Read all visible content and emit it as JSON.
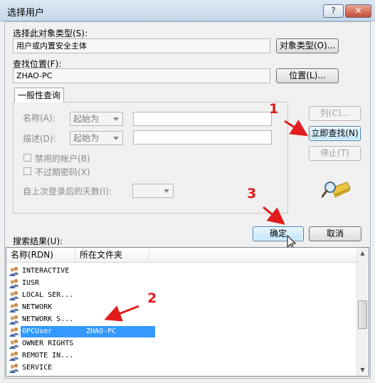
{
  "window": {
    "title": "选择用户",
    "help_label": "?",
    "close_label": "✕"
  },
  "object_type": {
    "label": "选择此对象类型(S):",
    "value": "用户或内置安全主体",
    "button": "对象类型(O)..."
  },
  "location": {
    "label": "查找位置(F):",
    "value": "ZHAO-PC",
    "button": "位置(L)..."
  },
  "query": {
    "tab": "一般性查询",
    "name_label": "名称(A):",
    "name_combo": "起始为",
    "desc_label": "描述(D):",
    "desc_combo": "起始为",
    "disabled_accounts": "禁用的帐户(B)",
    "no_expire_password": "不过期密码(X)",
    "days_since_login": "自上次登录后的天数(I):"
  },
  "side_buttons": {
    "columns": "列(C)...",
    "find_now": "立即查找(N)",
    "stop": "停止(T)"
  },
  "results": {
    "label": "搜索结果(U):",
    "col_name": "名称(RDN)",
    "col_folder": "所在文件夹",
    "rows": [
      {
        "name": "INTERACTIVE",
        "folder": ""
      },
      {
        "name": "IUSR",
        "folder": ""
      },
      {
        "name": "LOCAL SER...",
        "folder": ""
      },
      {
        "name": "NETWORK",
        "folder": ""
      },
      {
        "name": "NETWORK S...",
        "folder": ""
      },
      {
        "name": "OPCUser",
        "folder": "ZHAO-PC"
      },
      {
        "name": "OWNER RIGHTS",
        "folder": ""
      },
      {
        "name": "REMOTE IN...",
        "folder": ""
      },
      {
        "name": "SERVICE",
        "folder": ""
      }
    ],
    "selected_index": 5
  },
  "ok_button": "确定",
  "cancel_button": "取消",
  "annotations": {
    "one": "1",
    "two": "2",
    "three": "3"
  },
  "colors": {
    "annotation": "#e11c1c",
    "selection": "#3399ff"
  }
}
